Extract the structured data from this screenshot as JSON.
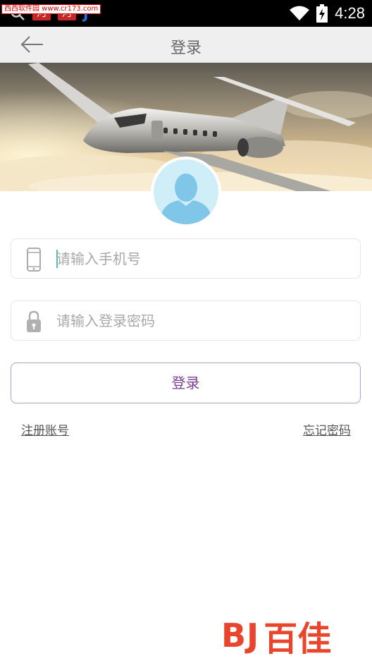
{
  "status_bar": {
    "watermark": "西西软件园 www.cr173.com",
    "app_icon_1": "河",
    "app_icon_2": "河",
    "app_icon_3": "J",
    "time": "4:28",
    "icons": [
      "search-icon",
      "wifi-icon",
      "battery-charging-icon"
    ]
  },
  "header": {
    "title": "登录",
    "back_icon": "arrow-left-icon"
  },
  "banner": {
    "image": "private-jet-over-clouds",
    "avatar_icon": "user-silhouette-icon"
  },
  "form": {
    "phone": {
      "icon": "phone-icon",
      "placeholder": "请输入手机号",
      "value": ""
    },
    "password": {
      "icon": "lock-icon",
      "placeholder": "请输入登录密码",
      "value": ""
    },
    "login_button": "登录"
  },
  "links": {
    "register": "注册账号",
    "forgot": "忘记密码"
  },
  "brand": {
    "logo": "BJ",
    "text": "百佳"
  },
  "colors": {
    "accent": "#7a3f8f",
    "button_border": "#b79cc8",
    "header_bg": "#efefef",
    "avatar_bg": "#cfeef8",
    "brand": "#e8452c"
  }
}
